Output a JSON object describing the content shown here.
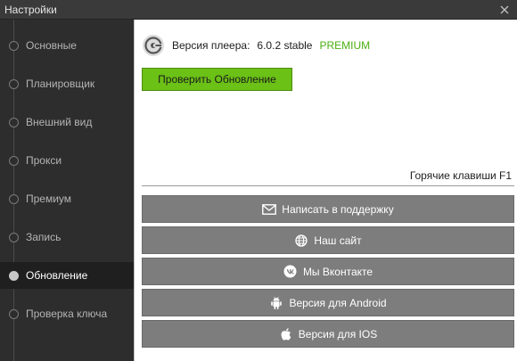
{
  "window": {
    "title": "Настройки"
  },
  "sidebar": {
    "items": [
      {
        "label": "Основные",
        "active": false
      },
      {
        "label": "Планировщик",
        "active": false
      },
      {
        "label": "Внешний вид",
        "active": false
      },
      {
        "label": "Прокси",
        "active": false
      },
      {
        "label": "Премиум",
        "active": false
      },
      {
        "label": "Запись",
        "active": false
      },
      {
        "label": "Обновление",
        "active": true
      },
      {
        "label": "Проверка ключа",
        "active": false
      }
    ]
  },
  "update": {
    "version_label": "Версия плеера:",
    "version_number": "6.0.2 stable",
    "edition": "PREMIUM",
    "check_button": "Проверить Обновление"
  },
  "hotkeys_label": "Горячие клавиши F1",
  "links": [
    {
      "label": "Написать в поддержку",
      "icon": "envelope-icon"
    },
    {
      "label": "Наш сайт",
      "icon": "globe-icon"
    },
    {
      "label": "Мы Вконтакте",
      "icon": "vk-icon"
    },
    {
      "label": "Версия для Android",
      "icon": "android-icon"
    },
    {
      "label": "Версия для IOS",
      "icon": "apple-icon"
    }
  ],
  "colors": {
    "accent_green": "#6bc116",
    "premium_green": "#4caf10",
    "link_button_gray": "#7d7d7d"
  }
}
